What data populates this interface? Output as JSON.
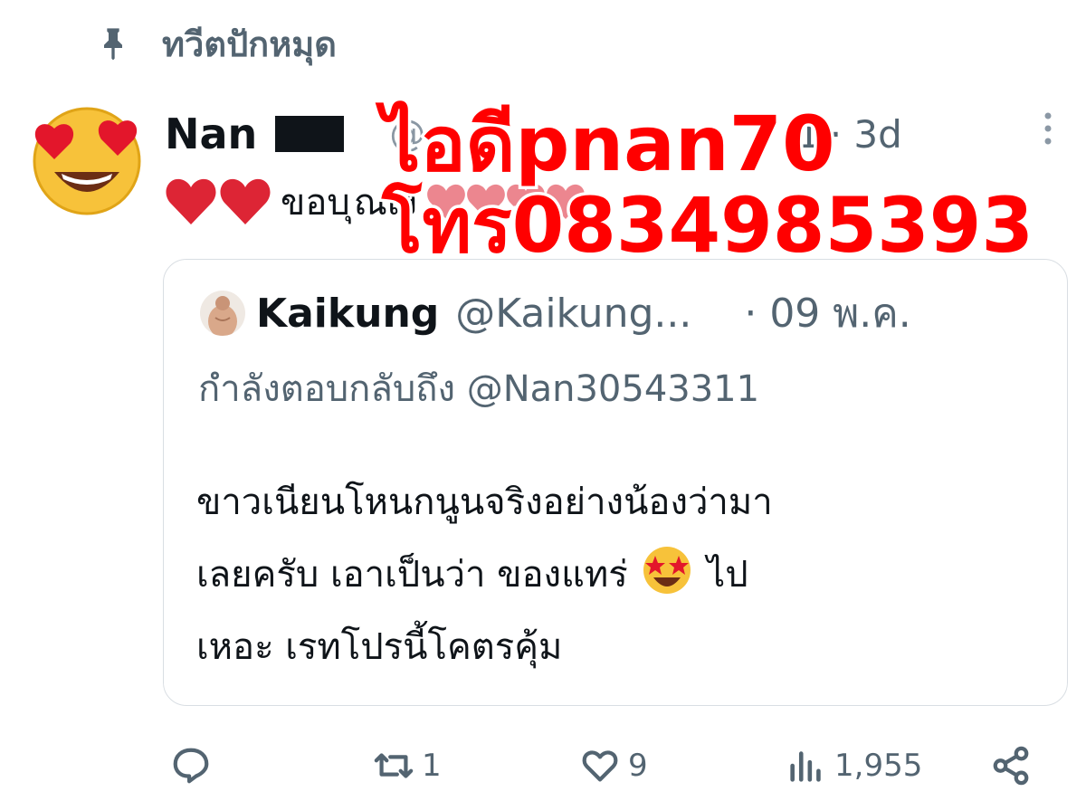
{
  "pinned": {
    "label": "ทวีตปักหมุด",
    "icon": "pin-icon"
  },
  "tweet": {
    "author": "Nan",
    "handle_fragment": "@",
    "handle_tail": "1",
    "time": "· 3d",
    "text": "ขอบ",
    "text_tail": "ุณเง้",
    "avatar_icon": "heart-eyes-emoji-icon",
    "reaction_icon": "red-heart-icon"
  },
  "quote": {
    "name": "Kaikung",
    "handle": "@Kaikung...",
    "time": "· 09 พ.ค.",
    "replying_to": "กำลังตอบกลับถึง @Nan30543311",
    "body_lines": [
      "ขาวเนียนโหนกนูนจริงอย่างน้องว่ามา",
      "เลยครับ เอาเป็นว่า ของแทร่",
      "ไป",
      "เหอะ เรทโปรนี้โคตรคุ้ม"
    ],
    "emoji_icon": "star-struck-emoji-icon"
  },
  "actions": {
    "reply_count": "",
    "retweet_count": "1",
    "like_count": "9",
    "views_count": "1,955"
  },
  "watermark": {
    "line1": "ไอดีpnan70",
    "line2": "โทร0834985393",
    "color": "#ff0000"
  }
}
